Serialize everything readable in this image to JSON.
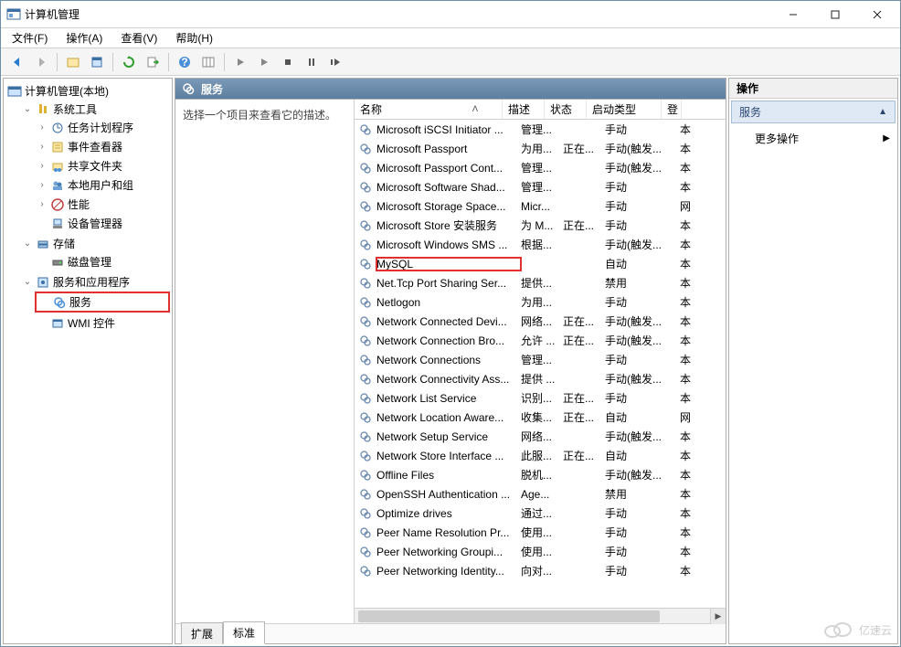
{
  "window": {
    "title": "计算机管理"
  },
  "menubar": {
    "file": "文件(F)",
    "action": "操作(A)",
    "view": "查看(V)",
    "help": "帮助(H)"
  },
  "toolbar_icons": [
    "back",
    "forward",
    "up",
    "properties",
    "refresh",
    "export",
    "help",
    "columns",
    "play",
    "play2",
    "stop",
    "pause",
    "restart"
  ],
  "tree": {
    "root": "计算机管理(本地)",
    "system_tools": "系统工具",
    "task_scheduler": "任务计划程序",
    "event_viewer": "事件查看器",
    "shared_folders": "共享文件夹",
    "local_users": "本地用户和组",
    "performance": "性能",
    "device_manager": "设备管理器",
    "storage": "存储",
    "disk_management": "磁盘管理",
    "services_apps": "服务和应用程序",
    "services": "服务",
    "wmi": "WMI 控件"
  },
  "mid": {
    "title": "服务",
    "desc": "选择一个项目来查看它的描述。"
  },
  "columns": {
    "name": "名称",
    "desc": "描述",
    "status": "状态",
    "startup": "启动类型",
    "logon": "登"
  },
  "tabs": {
    "ext": "扩展",
    "std": "标准"
  },
  "actions": {
    "header": "操作",
    "section": "服务",
    "more": "更多操作"
  },
  "services": [
    {
      "name": "Microsoft iSCSI Initiator ...",
      "desc": "管理...",
      "status": "",
      "start": "手动",
      "logon": "本"
    },
    {
      "name": "Microsoft Passport",
      "desc": "为用...",
      "status": "正在...",
      "start": "手动(触发...",
      "logon": "本"
    },
    {
      "name": "Microsoft Passport Cont...",
      "desc": "管理...",
      "status": "",
      "start": "手动(触发...",
      "logon": "本"
    },
    {
      "name": "Microsoft Software Shad...",
      "desc": "管理...",
      "status": "",
      "start": "手动",
      "logon": "本"
    },
    {
      "name": "Microsoft Storage Space...",
      "desc": "Micr...",
      "status": "",
      "start": "手动",
      "logon": "网"
    },
    {
      "name": "Microsoft Store 安装服务",
      "desc": "为 M...",
      "status": "正在...",
      "start": "手动",
      "logon": "本"
    },
    {
      "name": "Microsoft Windows SMS ...",
      "desc": "根据...",
      "status": "",
      "start": "手动(触发...",
      "logon": "本"
    },
    {
      "name": "MySQL",
      "desc": "",
      "status": "",
      "start": "自动",
      "logon": "本",
      "highlight": true
    },
    {
      "name": "Net.Tcp Port Sharing Ser...",
      "desc": "提供...",
      "status": "",
      "start": "禁用",
      "logon": "本"
    },
    {
      "name": "Netlogon",
      "desc": "为用...",
      "status": "",
      "start": "手动",
      "logon": "本"
    },
    {
      "name": "Network Connected Devi...",
      "desc": "网络...",
      "status": "正在...",
      "start": "手动(触发...",
      "logon": "本"
    },
    {
      "name": "Network Connection Bro...",
      "desc": "允许 ...",
      "status": "正在...",
      "start": "手动(触发...",
      "logon": "本"
    },
    {
      "name": "Network Connections",
      "desc": "管理...",
      "status": "",
      "start": "手动",
      "logon": "本"
    },
    {
      "name": "Network Connectivity Ass...",
      "desc": "提供 ...",
      "status": "",
      "start": "手动(触发...",
      "logon": "本"
    },
    {
      "name": "Network List Service",
      "desc": "识别...",
      "status": "正在...",
      "start": "手动",
      "logon": "本"
    },
    {
      "name": "Network Location Aware...",
      "desc": "收集...",
      "status": "正在...",
      "start": "自动",
      "logon": "网"
    },
    {
      "name": "Network Setup Service",
      "desc": "网络...",
      "status": "",
      "start": "手动(触发...",
      "logon": "本"
    },
    {
      "name": "Network Store Interface ...",
      "desc": "此服...",
      "status": "正在...",
      "start": "自动",
      "logon": "本"
    },
    {
      "name": "Offline Files",
      "desc": "脱机...",
      "status": "",
      "start": "手动(触发...",
      "logon": "本"
    },
    {
      "name": "OpenSSH Authentication ...",
      "desc": "Age...",
      "status": "",
      "start": "禁用",
      "logon": "本"
    },
    {
      "name": "Optimize drives",
      "desc": "通过...",
      "status": "",
      "start": "手动",
      "logon": "本"
    },
    {
      "name": "Peer Name Resolution Pr...",
      "desc": "使用...",
      "status": "",
      "start": "手动",
      "logon": "本"
    },
    {
      "name": "Peer Networking Groupi...",
      "desc": "使用...",
      "status": "",
      "start": "手动",
      "logon": "本"
    },
    {
      "name": "Peer Networking Identity...",
      "desc": "向对...",
      "status": "",
      "start": "手动",
      "logon": "本"
    }
  ],
  "watermark": "亿速云"
}
